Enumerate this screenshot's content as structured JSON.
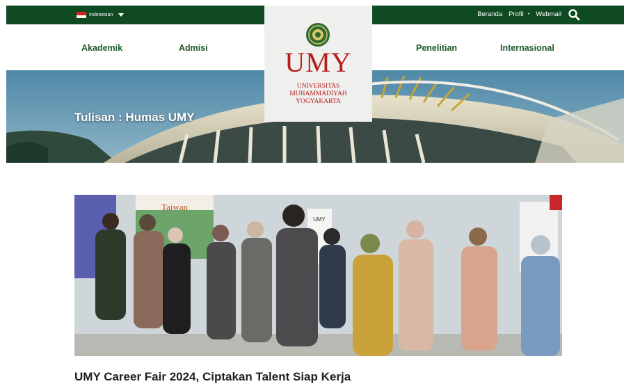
{
  "topbar": {
    "language": "Indonesian",
    "links": [
      "Beranda",
      "Profil",
      "Webmail"
    ]
  },
  "nav": {
    "items": [
      "Akademik",
      "Admisi",
      "Penelitian",
      "Internasional"
    ]
  },
  "logo": {
    "word": "UMY",
    "line1": "UNIVERSITAS",
    "line2": "MUHAMMADIYAH",
    "line3": "YOGYAKARTA"
  },
  "hero": {
    "title": "Tulisan : Humas UMY"
  },
  "article": {
    "title": "UMY Career Fair 2024, Ciptakan Talent Siap Kerja",
    "booth_sign": "Taiwan",
    "banner_sign": "UMY"
  },
  "colors": {
    "brand_green": "#0f4a22",
    "brand_red": "#b51d1d"
  }
}
